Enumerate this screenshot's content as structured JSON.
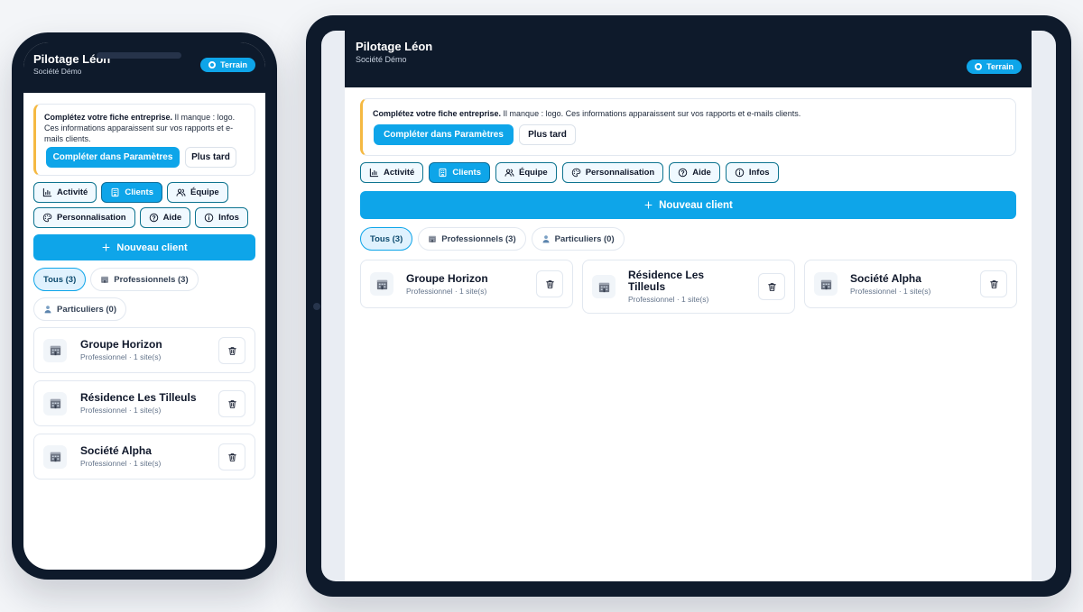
{
  "app": {
    "title": "Pilotage Léon",
    "subtitle": "Société Démo",
    "mode_badge": "Terrain"
  },
  "notice": {
    "bold": "Complétez votre fiche entreprise.",
    "text": " Il manque : logo. Ces informations apparaissent sur vos rapports et e-mails clients.",
    "primary_label": "Compléter dans Paramètres",
    "secondary_label": "Plus tard"
  },
  "tabs": [
    {
      "label": "Activité",
      "icon": "bar-chart-icon",
      "active": false
    },
    {
      "label": "Clients",
      "icon": "building-icon",
      "active": true
    },
    {
      "label": "Équipe",
      "icon": "users-icon",
      "active": false
    },
    {
      "label": "Personnalisation",
      "icon": "palette-icon",
      "active": false
    },
    {
      "label": "Aide",
      "icon": "help-circle-icon",
      "active": false
    },
    {
      "label": "Infos",
      "icon": "info-icon",
      "active": false
    }
  ],
  "new_client_label": "Nouveau client",
  "filters": [
    {
      "label": "Tous (3)",
      "icon": "",
      "active": true
    },
    {
      "label": "Professionnels (3)",
      "icon": "office-building-icon",
      "active": false
    },
    {
      "label": "Particuliers (0)",
      "icon": "person-icon",
      "active": false
    }
  ],
  "clients": [
    {
      "name": "Groupe Horizon",
      "meta": "Professionnel · 1 site(s)"
    },
    {
      "name": "Résidence Les Tilleuls",
      "meta": "Professionnel · 1 site(s)"
    },
    {
      "name": "Société Alpha",
      "meta": "Professionnel · 1 site(s)"
    }
  ],
  "colors": {
    "header_bg": "#0e1a2b",
    "accent": "#0ea5e9",
    "notice_accent": "#f5b942"
  }
}
